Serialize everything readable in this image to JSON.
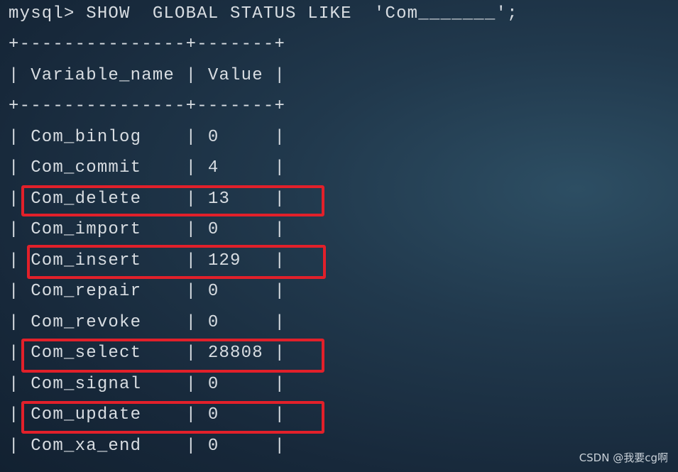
{
  "terminal": {
    "command": "mysql> SHOW  GLOBAL STATUS LIKE  'Com_______';",
    "border": "+---------------+-------+",
    "header": "| Variable_name | Value |",
    "rows": [
      "| Com_binlog    | 0     |",
      "| Com_commit    | 4     |",
      "| Com_delete    | 13    |",
      "| Com_import    | 0     |",
      "| Com_insert    | 129   |",
      "| Com_repair    | 0     |",
      "| Com_revoke    | 0     |",
      "| Com_select    | 28808 |",
      "| Com_signal    | 0     |",
      "| Com_update    | 0     |",
      "| Com_xa_end    | 0     |"
    ],
    "highlighted_variables": [
      "Com_delete",
      "Com_insert",
      "Com_select",
      "Com_update"
    ]
  },
  "colors": {
    "text": "#d8dde2",
    "highlight_box": "#e2202a"
  },
  "watermark": "CSDN @我要cg啊"
}
